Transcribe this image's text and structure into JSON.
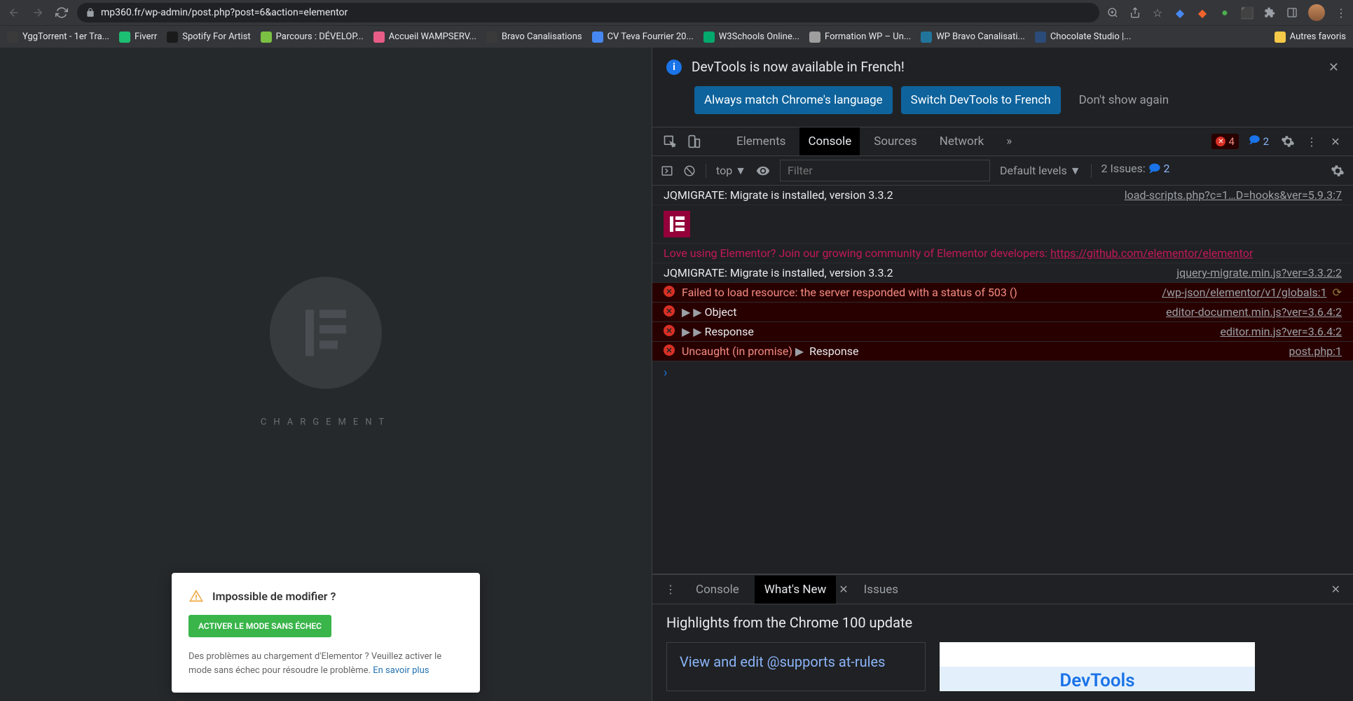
{
  "browser": {
    "url": "mp360.fr/wp-admin/post.php?post=6&action=elementor"
  },
  "bookmarks": [
    {
      "label": "YggTorrent - 1er Tra...",
      "color": "#3a3a3a"
    },
    {
      "label": "Fiverr",
      "color": "#1dbf73"
    },
    {
      "label": "Spotify For Artist",
      "color": "#1a1a1a"
    },
    {
      "label": "Parcours : DÉVELOP...",
      "color": "#7bc043"
    },
    {
      "label": "Accueil WAMPSERV...",
      "color": "#e85d88"
    },
    {
      "label": "Bravo Canalisations",
      "color": "#3a3a3a"
    },
    {
      "label": "CV Teva Fourrier 20...",
      "color": "#4688f1"
    },
    {
      "label": "W3Schools Online...",
      "color": "#04aa6d"
    },
    {
      "label": "Formation WP – Un...",
      "color": "#9e9e9e"
    },
    {
      "label": "WP Bravo Canalisati...",
      "color": "#21759b"
    },
    {
      "label": "Chocolate Studio |...",
      "color": "#2b4b7a"
    }
  ],
  "bookmarks_other": "Autres favoris",
  "elementor": {
    "loading_label": "CHARGEMENT"
  },
  "modal": {
    "title": "Impossible de modifier ?",
    "button": "ACTIVER LE MODE SANS ÉCHEC",
    "text": "Des problèmes au chargement d'Elementor ? Veuillez activer le mode sans échec pour résoudre le problème. ",
    "link": "En savoir plus"
  },
  "devtools": {
    "banner": {
      "text": "DevTools is now available in French!",
      "btn1": "Always match Chrome's language",
      "btn2": "Switch DevTools to French",
      "btn3": "Don't show again"
    },
    "tabs": {
      "elements": "Elements",
      "console": "Console",
      "sources": "Sources",
      "network": "Network"
    },
    "error_count": "4",
    "issue_count": "2",
    "console_toolbar": {
      "context": "top",
      "filter_placeholder": "Filter",
      "levels": "Default levels",
      "issues_label": "2 Issues:",
      "issues_count": "2"
    },
    "logs": [
      {
        "type": "info",
        "msg": "JQMIGRATE: Migrate is installed, version 3.3.2",
        "src": "load-scripts.php?c=1…D=hooks&ver=5.9.3:7"
      },
      {
        "type": "elementor-badge"
      },
      {
        "type": "elementor-msg",
        "msg": "Love using Elementor? Join our growing community of Elementor developers: ",
        "link": "https://github.com/elementor/elementor"
      },
      {
        "type": "info",
        "msg": "JQMIGRATE: Migrate is installed, version 3.3.2",
        "src": "jquery-migrate.min.js?ver=3.3.2:2"
      },
      {
        "type": "error",
        "msg": "Failed to load resource: the server responded with a status of 503 ()",
        "src": "/wp-json/elementor/v1/globals:1",
        "reload": true
      },
      {
        "type": "error-obj",
        "expand": "▶ ▶",
        "obj": "Object",
        "src": "editor-document.min.js?ver=3.6.4:2"
      },
      {
        "type": "error-obj",
        "expand": "▶ ▶",
        "obj": "Response",
        "src": "editor.min.js?ver=3.6.4:2"
      },
      {
        "type": "error-uncaught",
        "prefix": "Uncaught (in promise)",
        "expand": "▶",
        "obj": "Response",
        "src": "post.php:1"
      }
    ],
    "drawer": {
      "tab_console": "Console",
      "tab_whatsnew": "What's New",
      "tab_issues": "Issues",
      "headline": "Highlights from the Chrome 100 update",
      "card_title": "View and edit @supports at-rules",
      "img_text": "DevTools"
    }
  }
}
